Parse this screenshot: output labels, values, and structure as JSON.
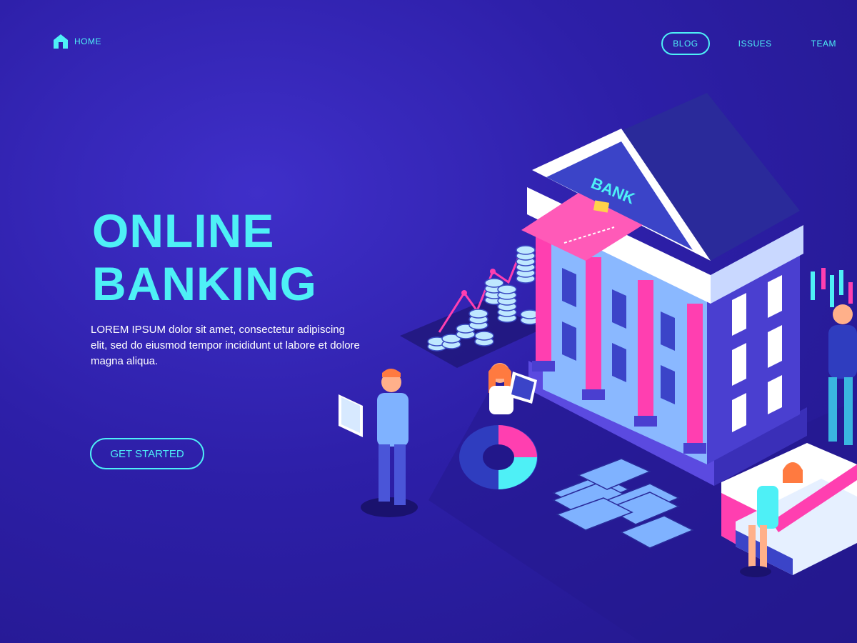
{
  "nav": {
    "home_label": "HOME",
    "links": [
      {
        "label": "BLOG",
        "active": true
      },
      {
        "label": "ISSUES",
        "active": false
      },
      {
        "label": "TEAM",
        "active": false
      }
    ]
  },
  "hero": {
    "title_line1": "ONLINE",
    "title_line2": "BANKING",
    "description": "LOREM IPSUM dolor sit amet, consectetur adipiscing elit, sed do eiusmod tempor incididunt ut labore et dolore magna aliqua.",
    "cta_label": "GET STARTED"
  },
  "illustration": {
    "bank_sign": "BANK"
  },
  "colors": {
    "background": "#2d1fa8",
    "accent": "#4ef0f6",
    "pink": "#ff3fb0"
  },
  "icons": [
    "home-icon"
  ]
}
